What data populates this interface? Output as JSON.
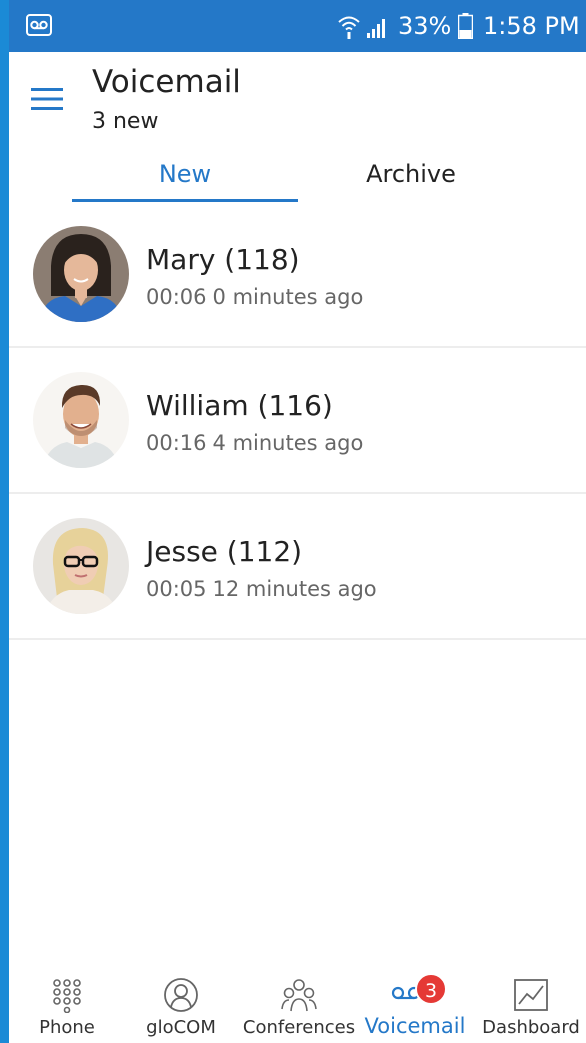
{
  "status_bar": {
    "battery": "33%",
    "time": "1:58 PM",
    "icons": [
      "voicemail-icon",
      "wifi-icon",
      "signal-icon",
      "battery-icon"
    ]
  },
  "header": {
    "title": "Voicemail",
    "subtitle": "3 new"
  },
  "tabs": [
    {
      "label": "New",
      "active": true
    },
    {
      "label": "Archive",
      "active": false
    }
  ],
  "voicemails": [
    {
      "name": "Mary (118)",
      "duration": "00:06",
      "age": "0 minutes ago"
    },
    {
      "name": "William (116)",
      "duration": "00:16",
      "age": "4 minutes ago"
    },
    {
      "name": "Jesse (112)",
      "duration": "00:05",
      "age": "12 minutes ago"
    }
  ],
  "bottom_nav": {
    "items": [
      {
        "label": "Phone",
        "icon": "dialpad-icon"
      },
      {
        "label": "gloCOM",
        "icon": "user-icon"
      },
      {
        "label": "Conferences",
        "icon": "group-icon"
      },
      {
        "label": "Voicemail",
        "icon": "voicemail-icon",
        "active": true,
        "badge": "3"
      },
      {
        "label": "Dashboard",
        "icon": "chart-icon"
      }
    ]
  },
  "colors": {
    "accent": "#2478c8",
    "status_bar": "#2478c8",
    "badge": "#e53935"
  }
}
